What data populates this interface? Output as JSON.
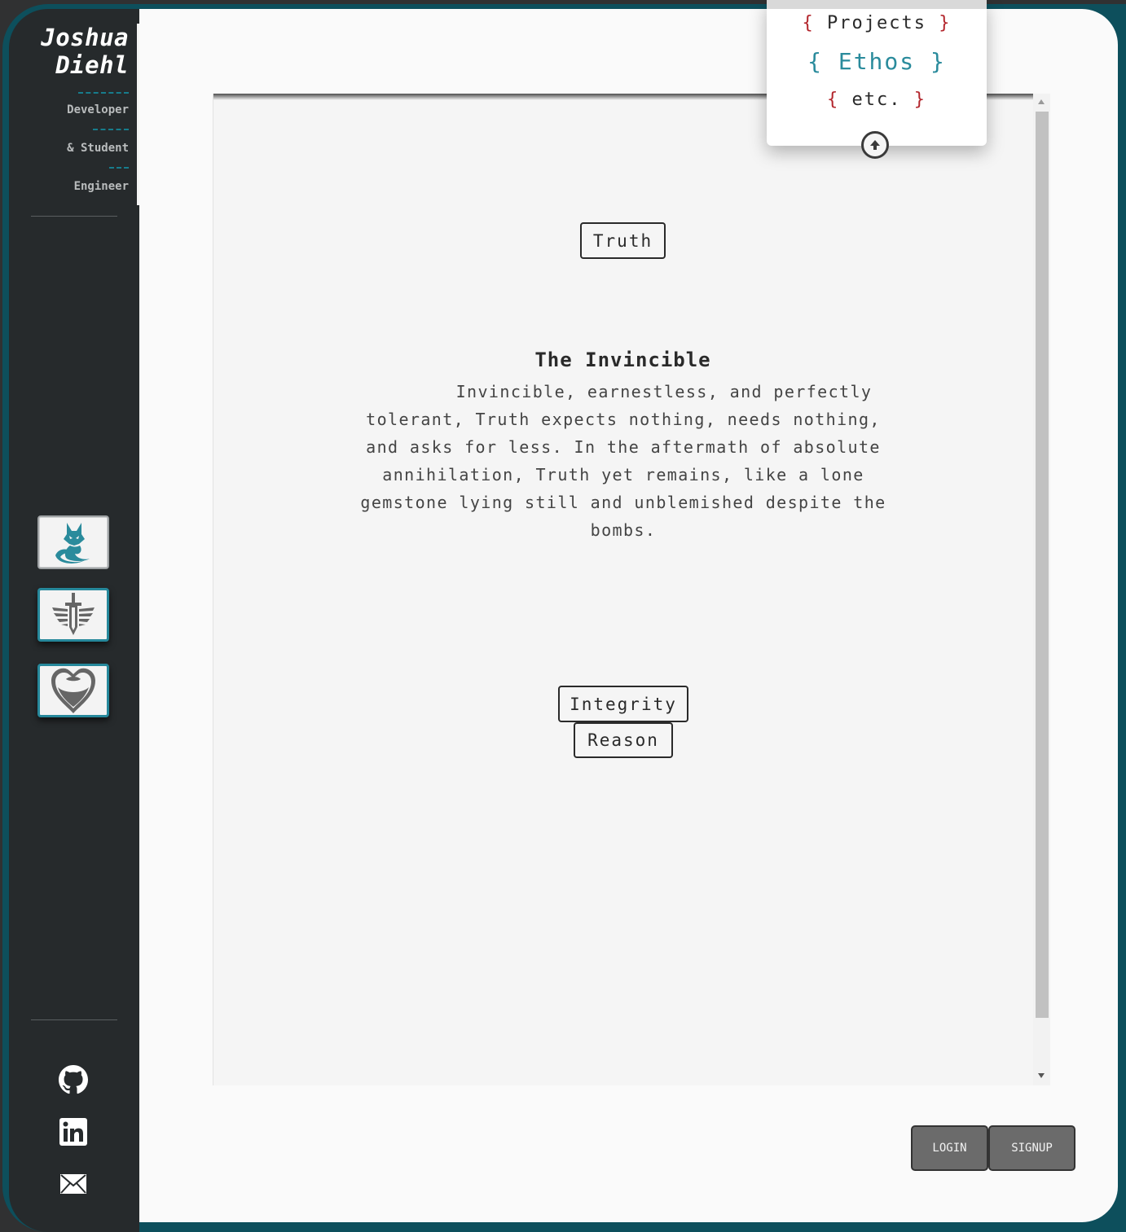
{
  "sidebar": {
    "name_first": "Joshua",
    "name_last": "Diehl",
    "roles": [
      "Developer",
      "& Student",
      "Engineer"
    ],
    "nav": [
      {
        "icon": "fox-icon",
        "active": true
      },
      {
        "icon": "winged-sword-icon",
        "active": false
      },
      {
        "icon": "heart-icon",
        "active": false
      }
    ],
    "social": [
      {
        "icon": "github-icon"
      },
      {
        "icon": "linkedin-icon"
      },
      {
        "icon": "mail-icon"
      }
    ]
  },
  "menu": {
    "items": [
      {
        "label": "Projects",
        "open": "{",
        "close": "}"
      },
      {
        "label": "Ethos",
        "open": "{",
        "close": "}",
        "active": true
      },
      {
        "label": "etc.",
        "open": "{",
        "close": "}"
      }
    ]
  },
  "content": {
    "top_tag": "Truth",
    "heading": "The Invincible",
    "body": "Invincible, earnestless, and perfectly tolerant, Truth expects nothing, needs nothing, and asks for less. In the aftermath of absolute annihilation, Truth yet remains, like a lone gemstone lying still and unblemished despite the bombs.",
    "bottom_tags": [
      "Integrity",
      "Reason"
    ]
  },
  "auth": {
    "login": "LOGIN",
    "signup": "SIGNUP"
  },
  "colors": {
    "accent_teal": "#2a8b9c",
    "accent_red": "#b3262d",
    "sidebar_bg": "#262a2c"
  }
}
